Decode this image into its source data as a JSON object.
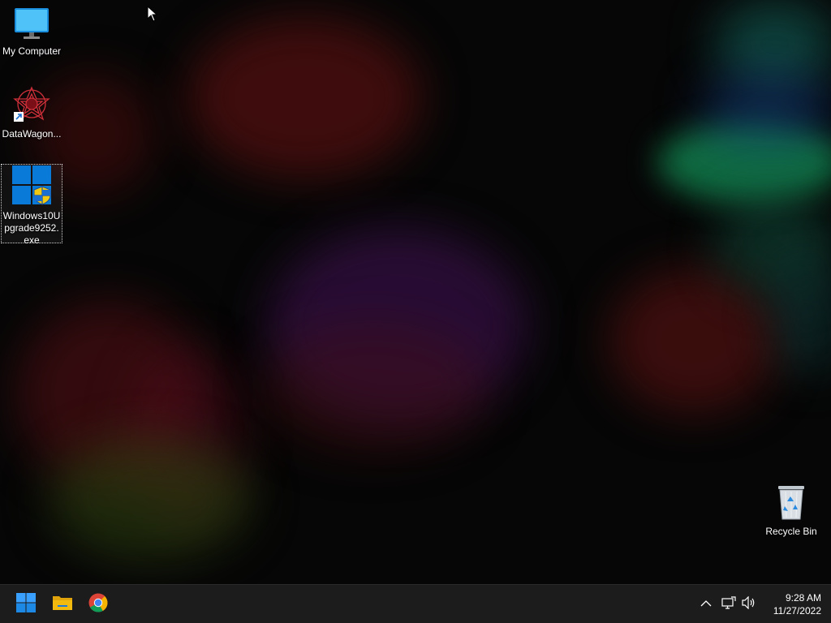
{
  "desktop": {
    "icons": [
      {
        "label": "My Computer",
        "icon": "monitor-icon"
      },
      {
        "label": "DataWagon...",
        "icon": "datawagon-logo-icon",
        "shortcut": true
      },
      {
        "label": "Windows10Upgrade9252.exe",
        "icon": "windows-upgrade-icon",
        "selected": true
      },
      {
        "label": "Recycle Bin",
        "icon": "recycle-bin-icon"
      }
    ]
  },
  "taskbar": {
    "pinned": [
      {
        "name": "Start",
        "icon": "windows-start-icon"
      },
      {
        "name": "File Explorer",
        "icon": "folder-icon"
      },
      {
        "name": "Google Chrome",
        "icon": "chrome-icon"
      }
    ],
    "tray": {
      "icons": [
        "chevron-up-icon",
        "network-icon",
        "volume-icon"
      ],
      "time": "9:28 AM",
      "date": "11/27/2022"
    }
  },
  "colors": {
    "taskbar_bg": "#1c1c1c",
    "windows_blue": "#0a7ad8",
    "folder_yellow": "#f2b90f"
  }
}
